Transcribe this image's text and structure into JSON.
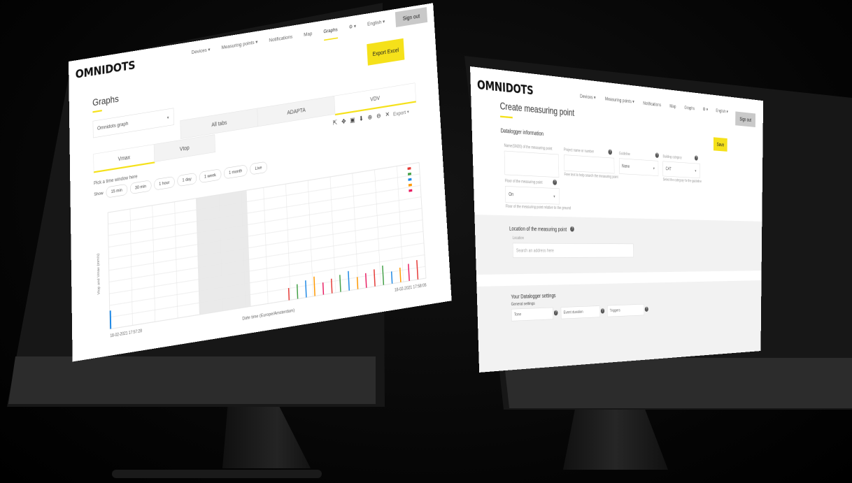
{
  "left_screen": {
    "logo": "OMNIDOTS",
    "nav": [
      "Devices ▾",
      "Measuring points ▾",
      "Notifications",
      "Map",
      "Graphs",
      "⚙ ▾",
      "English ▾"
    ],
    "nav_active_index": 4,
    "sign_out": "Sign out",
    "export_button": "Export Excel",
    "page_title": "Graphs",
    "device_select": "Omnidots graph",
    "tabs_top": [
      "All tabs",
      "ADAPTA",
      "VDV"
    ],
    "tabs_bottom": [
      "Vmax",
      "Vtop"
    ],
    "export_label": "Export",
    "section_label": "Pick a time window here",
    "range_prefix": "Show",
    "range_pills": [
      "15 min",
      "30 min",
      "1 hour",
      "1 day",
      "1 week",
      "1 month",
      "Live"
    ],
    "tool_icons": [
      "select-icon",
      "pan-icon",
      "box-zoom-icon",
      "download-icon",
      "zoom-in-icon",
      "zoom-out-icon",
      "reset-icon"
    ],
    "y_axis_label": "Vtop and Vmax (mm/s)",
    "x_axis_label": "Date time (Europe/Amsterdam)",
    "date_left": "18-02-2021 17:57:28",
    "date_right": "18-02-2021 17:58:05",
    "colors": {
      "accent": "#f5e11a",
      "legend": [
        "#e53935",
        "#43a047",
        "#1e88e5",
        "#ff9800",
        "#e91e63"
      ]
    }
  },
  "right_screen": {
    "logo": "OMNIDOTS",
    "nav": [
      "Devices ▾",
      "Measuring points ▾",
      "Notifications",
      "Map",
      "Graphs",
      "⚙ ▾",
      "English ▾"
    ],
    "sign_out": "Sign out",
    "page_title": "Create measuring point",
    "save_button": "Save",
    "sections": {
      "general": "Datalogger information",
      "location": "Location of the measuring point",
      "settings": "Your Datalogger settings",
      "general_settings": "General settings"
    },
    "fields": {
      "name_label": "Name(SN20) of the measuring point",
      "ref_label": "Project name or number",
      "ref_hint": "Free text to help search the measuring point",
      "guide_label": "Guideline",
      "guide_value": "None",
      "category_label": "Building category",
      "category_value": "CAT",
      "category_hint": "Select the category for the guideline",
      "floor_label": "Floor of the measuring point",
      "floor_value": "On",
      "floor_hint": "Floor of the measuring point relative to the ground",
      "location_label": "Location",
      "location_placeholder": "Search an address here",
      "setting1": "Tone",
      "setting2": "Event duration",
      "setting3": "Triggers"
    }
  }
}
